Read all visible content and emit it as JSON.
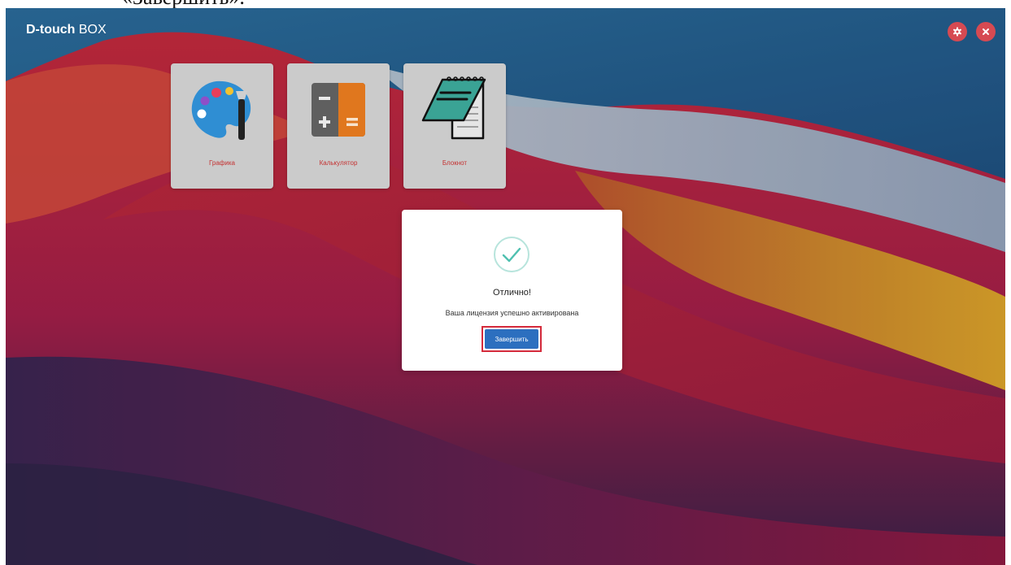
{
  "doc": {
    "top_text": "«Завершить»."
  },
  "app": {
    "title_bold": "D-touch",
    "title_rest": " BOX",
    "buttons": [
      {
        "name": "settings",
        "icon": "gear-icon"
      },
      {
        "name": "close",
        "icon": "close-icon"
      }
    ]
  },
  "tiles": [
    {
      "label": "Графика",
      "icon": "palette-icon"
    },
    {
      "label": "Калькулятор",
      "icon": "calculator-icon"
    },
    {
      "label": "Блокнот",
      "icon": "notepad-icon"
    }
  ],
  "dialog": {
    "icon": "check-circle-icon",
    "heading": "Отлично!",
    "message": "Ваша лицензия успешно активирована",
    "finish_label": "Завершить"
  },
  "colors": {
    "accent_button": "#2c6fbf",
    "success_check": "#4fc0b0",
    "top_button": "#d64a52",
    "highlight_border": "#d52b3b",
    "tile_label": "#c43131"
  }
}
